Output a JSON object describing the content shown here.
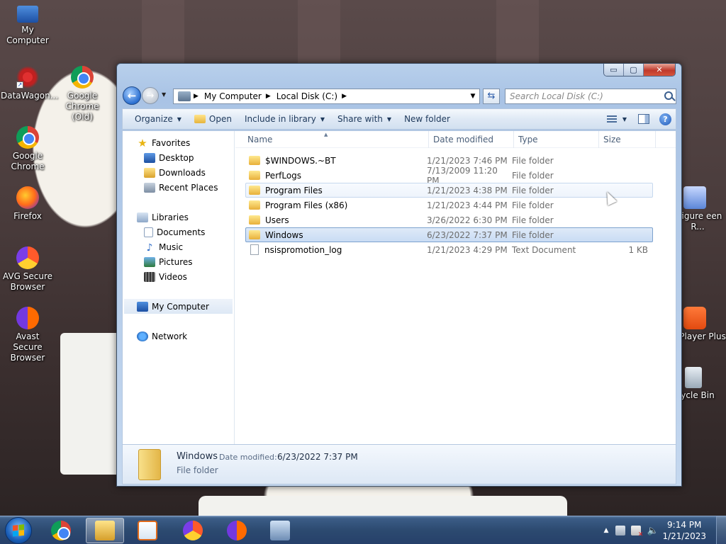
{
  "desktop": {
    "icons_left": [
      {
        "label": "My Computer",
        "icon": "computer-icon"
      },
      {
        "label": "DataWagon...",
        "icon": "datawagon-icon"
      },
      {
        "label": "Google Chrome (Old)",
        "icon": "chrome-icon"
      },
      {
        "label": "Google Chrome",
        "icon": "chrome-icon"
      },
      {
        "label": "Firefox",
        "icon": "firefox-icon"
      },
      {
        "label": "AVG Secure Browser",
        "icon": "avg-icon"
      },
      {
        "label": "Avast Secure Browser",
        "icon": "avast-icon"
      }
    ],
    "icons_right": [
      {
        "label": "nfigure een R...",
        "icon": "configure-icon"
      },
      {
        "label": "M Player Plus",
        "icon": "gom-player-icon"
      },
      {
        "label": "ycle Bin",
        "icon": "recycle-bin-icon"
      }
    ]
  },
  "window": {
    "caption_buttons": {
      "minimize": "▭",
      "maximize": "▢",
      "close": "✕"
    },
    "breadcrumb": [
      "My Computer",
      "Local Disk (C:)"
    ],
    "search_placeholder": "Search Local Disk (C:)",
    "toolbar": {
      "organize": "Organize",
      "open": "Open",
      "include_in_library": "Include in library",
      "share_with": "Share with",
      "new_folder": "New folder"
    },
    "nav": {
      "favorites_label": "Favorites",
      "favorites": [
        "Desktop",
        "Downloads",
        "Recent Places"
      ],
      "libraries_label": "Libraries",
      "libraries": [
        "Documents",
        "Music",
        "Pictures",
        "Videos"
      ],
      "computer_label": "My Computer",
      "network_label": "Network"
    },
    "columns": {
      "name": "Name",
      "date": "Date modified",
      "type": "Type",
      "size": "Size"
    },
    "files": [
      {
        "name": "$WINDOWS.~BT",
        "date": "1/21/2023 7:46 PM",
        "type": "File folder",
        "size": ""
      },
      {
        "name": "PerfLogs",
        "date": "7/13/2009 11:20 PM",
        "type": "File folder",
        "size": ""
      },
      {
        "name": "Program Files",
        "date": "1/21/2023 4:38 PM",
        "type": "File folder",
        "size": ""
      },
      {
        "name": "Program Files (x86)",
        "date": "1/21/2023 4:44 PM",
        "type": "File folder",
        "size": ""
      },
      {
        "name": "Users",
        "date": "3/26/2022 6:30 PM",
        "type": "File folder",
        "size": ""
      },
      {
        "name": "Windows",
        "date": "6/23/2022 7:37 PM",
        "type": "File folder",
        "size": ""
      },
      {
        "name": "nsispromotion_log",
        "date": "1/21/2023 4:29 PM",
        "type": "Text Document",
        "size": "1 KB"
      }
    ],
    "details": {
      "name": "Windows",
      "date_label": "Date modified:",
      "date": "6/23/2022 7:37 PM",
      "type": "File folder"
    }
  },
  "taskbar": {
    "clock_time": "9:14 PM",
    "clock_date": "1/21/2023"
  }
}
